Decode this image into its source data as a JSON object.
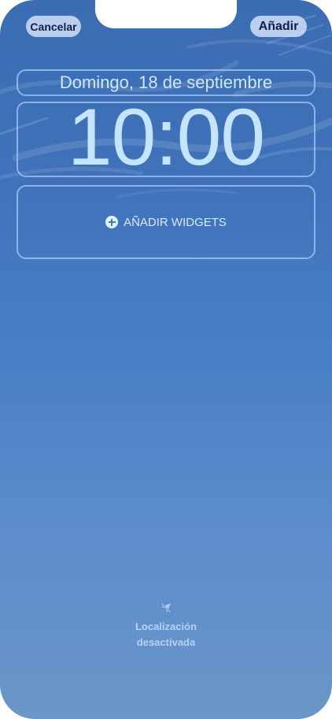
{
  "top_bar": {
    "cancel_label": "Cancelar",
    "add_label": "Añadir"
  },
  "lock_screen": {
    "date": "Domingo, 18 de septiembre",
    "time": "10:00",
    "add_widgets_label": "AÑADIR WIDGETS"
  },
  "location_status": {
    "icon": "location-off-icon",
    "line1": "Localización",
    "line2": "desactivada"
  },
  "colors": {
    "wallpaper_top": "#3c6db3",
    "wallpaper_bottom": "#6a96c8",
    "clock_text": "#c4e4ff",
    "button_bg": "#cddcf5",
    "button_text": "#0d1f4a"
  }
}
